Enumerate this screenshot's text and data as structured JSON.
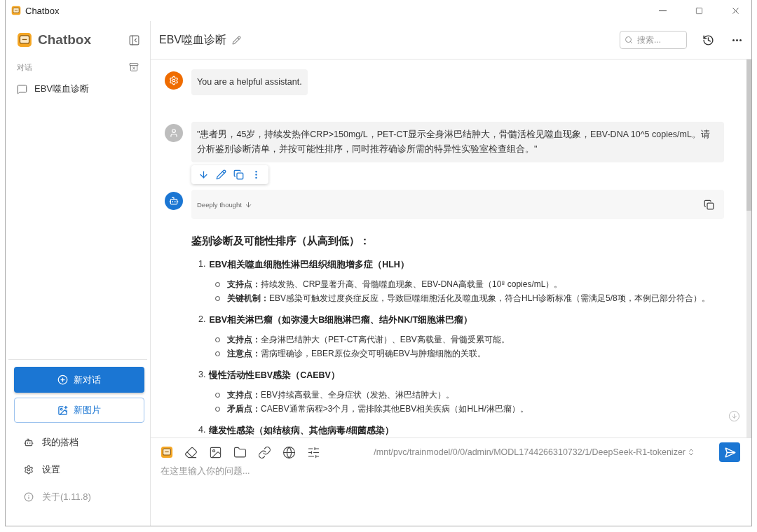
{
  "window": {
    "title": "Chatbox"
  },
  "sidebar": {
    "app_name": "Chatbox",
    "section_label": "对话",
    "conversations": [
      {
        "title": "EBV噬血诊断"
      }
    ],
    "new_chat": "新对话",
    "new_image": "新图片",
    "menu": [
      {
        "kind": "partner",
        "label": "我的搭档",
        "disabled": false
      },
      {
        "kind": "settings",
        "label": "设置",
        "disabled": false
      },
      {
        "kind": "about",
        "label": "关于(1.11.8)",
        "disabled": true
      }
    ]
  },
  "header": {
    "title": "EBV噬血诊断",
    "search": {
      "placeholder": "搜索..."
    }
  },
  "messages": [
    {
      "kind": "system",
      "text": "You are a helpful assistant."
    },
    {
      "kind": "user",
      "text": "\"患者男，45岁，持续发热伴CRP>150mg/L，PET-CT显示全身淋巴结肿大，骨髓活检见噬血现象，EBV-DNA 10^5 copies/mL。请分析鉴别诊断清单，并按可能性排序，同时推荐确诊所需的特异性实验室检查组合。\""
    },
    {
      "kind": "assistant",
      "thinking_label": "Deeply thought",
      "heading": "鉴别诊断及可能性排序（从高到低）：",
      "items": [
        {
          "number": "1.",
          "title": "EBV相关噬血细胞性淋巴组织细胞增多症（HLH）",
          "points": [
            "**支持点：**持续发热、CRP显著升高、骨髓噬血现象、EBV-DNA高载量（10⁸ copies/mL）。",
            "**关键机制：**EBV感染可触发过度炎症反应，导致巨噬细胞活化及噬血现象，符合HLH诊断标准（需满足5/8项，本例已部分符合）。"
          ]
        },
        {
          "number": "2.",
          "title": "EBV相关淋巴瘤（如弥漫大B细胞淋巴瘤、结外NK/T细胞淋巴瘤）",
          "points": [
            "**支持点：**全身淋巴结肿大（PET-CT高代谢）、EBV高载量、骨髓受累可能。",
            "**注意点：**需病理确诊，EBER原位杂交可明确EBV与肿瘤细胞的关联。"
          ]
        },
        {
          "number": "3.",
          "title": "慢性活动性EBV感染（CAEBV）",
          "points": [
            "**支持点：**EBV持续高载量、全身症状（发热、淋巴结肿大）。",
            "**矛盾点：**CAEBV通常病程>3个月，需排除其他EBV相关疾病（如HLH/淋巴瘤）。"
          ]
        },
        {
          "number": "4.",
          "title": "继发性感染（如结核病、其他病毒/细菌感染）"
        }
      ]
    }
  ],
  "composer": {
    "model": "/mnt/pvc/trainmodel/0/0/admin/MODL1744266310732/1/DeepSeek-R1-tokenizer",
    "placeholder": "在这里输入你的问题..."
  }
}
